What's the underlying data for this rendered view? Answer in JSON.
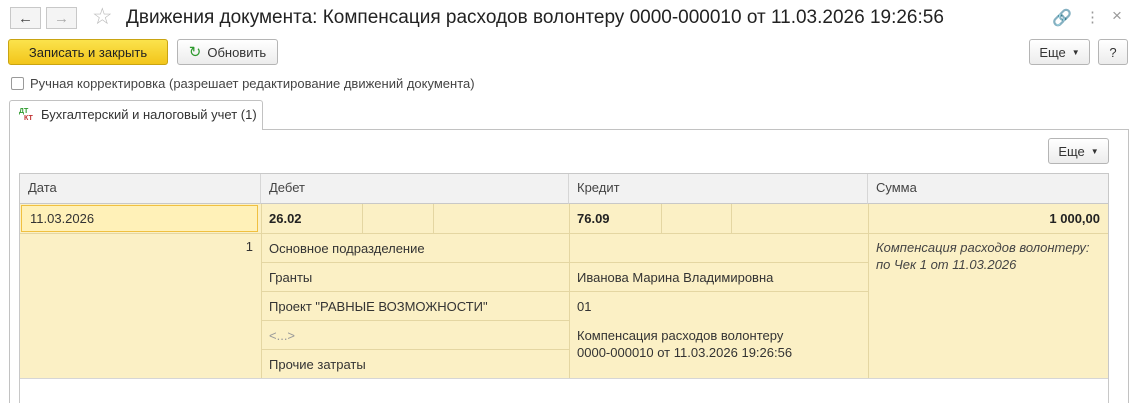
{
  "window": {
    "title": "Движения документа: Компенсация расходов волонтеру 0000-000010 от 11.03.2026 19:26:56",
    "back_icon": "arrow-left-icon",
    "forward_icon": "arrow-right-icon",
    "favorite_icon": "star-icon",
    "link_icon": "link-icon",
    "menu_icon": "more-vert-icon",
    "close_icon": "close-icon"
  },
  "toolbar": {
    "save_close_label": "Записать и закрыть",
    "refresh_label": "Обновить",
    "more_label": "Еще",
    "help_label": "?"
  },
  "manual": {
    "label": "Ручная корректировка (разрешает редактирование движений документа)",
    "checked": false
  },
  "tabs": [
    {
      "label": "Бухгалтерский и налоговый учет (1)",
      "icon_top": "ДТ",
      "icon_bottom": "КТ"
    }
  ],
  "table_toolbar": {
    "more_label": "Еще"
  },
  "table": {
    "columns": [
      "Дата",
      "Дебет",
      "Кредит",
      "Сумма"
    ],
    "rows": [
      {
        "date": "11.03.2026",
        "line_no": "1",
        "debit_account": "26.02",
        "debit_lines": [
          "Основное подразделение",
          "Гранты",
          "Проект \"РАВНЫЕ ВОЗМОЖНОСТИ\"",
          "<...>",
          "Прочие затраты"
        ],
        "credit_account": "76.09",
        "credit_lines": [
          "",
          "Иванова Марина Владимировна",
          "01",
          "Компенсация расходов волонтеру",
          "0000-000010 от 11.03.2026 19:26:56"
        ],
        "amount": "1 000,00",
        "content": [
          "Компенсация расходов волонтеру:",
          "по Чек 1 от 11.03.2026"
        ]
      }
    ]
  }
}
